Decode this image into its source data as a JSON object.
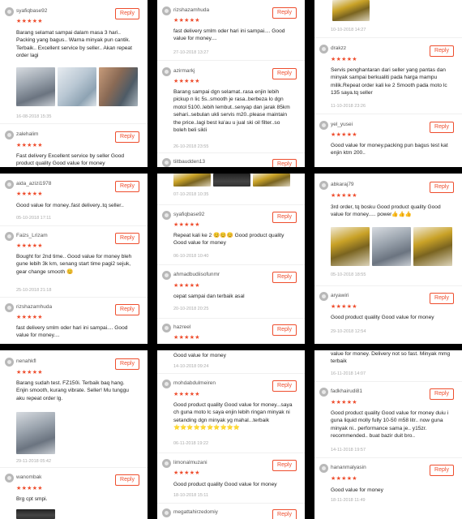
{
  "reply_label": "Reply",
  "stars": "★★★★★",
  "accent_color": "#ee4d2d",
  "tiles": [
    {
      "reviews": [
        {
          "user": "syafiqbase92",
          "text": "Barang selamat sampai dalam masa 3 hari.. Packing yang bagus.. Warna minyak pun cantik. Terbaik.. Excellent service by seller.. Akan repeat order lagi",
          "time": "16-08-2018 15:35"
        },
        {
          "user": "zalehalim",
          "text": "Fast delivery Excellent service by seller Good product quality Good value for money",
          "time": ""
        }
      ]
    },
    {
      "reviews": [
        {
          "user": "rizshazamhuda",
          "text": "fast delivery smlm oder hari ini sampai.... Good value for money....",
          "time": "27-10-2018 13:27"
        },
        {
          "user": "azirmarkj",
          "text": "Barang sampai dgn selamat..rasa enjin lebih pickup n lic 5s..smooth je rasa..berbeza lo dgn motol 5100..lebih lembut..senyap dan jarak 85km sehari..sebulan ukli servis m20..please maintain the price..lagi best ka'au u jual ski oil filter..so boleh beli sikli",
          "time": "26-10-2018 23:55"
        },
        {
          "user": "tiitbaudden13",
          "text": "",
          "time": ""
        }
      ]
    },
    {
      "reviews": [
        {
          "user": "",
          "text": "",
          "time": "10-10-2018 14:27"
        },
        {
          "user": "drakzz",
          "text": "Servis penghantaran dari seller yang pantas dan minyak sampai berkualiti pada harga mampu milik.Repeat order kali ke 2 Smooth pada moto lc 135 saya.tq seller",
          "time": "11-10-2018 23:26"
        },
        {
          "user": "yel_yusei",
          "text": "Good value for money.packing pun bagus test kat enjin ktm 200..",
          "time": ""
        }
      ]
    },
    {
      "reviews": [
        {
          "user": "aida_azizi1978",
          "text": "Good value for money..fast delivery..tq seller..",
          "time": "05-10-2018 17:11"
        },
        {
          "user": "Faizs_Lrizam",
          "text": "Bought for 2nd time.. Good value for money bleh gune lebih 3k km, senang start time pagi2 sejuk, gear change smooth 😊",
          "time": "25-10-2018 21:18"
        },
        {
          "user": "rizshazamhuda",
          "text": "fast delivery smlm oder hari ini sampai.... Good value for money....",
          "time": ""
        }
      ]
    },
    {
      "reviews": [
        {
          "user": "",
          "text": "",
          "time": "07-10-2018 10:35"
        },
        {
          "user": "syafiqbase92",
          "text": "Repeat kali ke 2 😊😊😊 Good product quality Good value for money",
          "time": "06-10-2018 10:40"
        },
        {
          "user": "ahmadbudiisofunmr",
          "text": "cepat sampai dan terbaik asal",
          "time": "20-10-2018 20:25"
        },
        {
          "user": "hazreel",
          "text": "",
          "time": ""
        }
      ]
    },
    {
      "reviews": [
        {
          "user": "abkaraj79",
          "text": "3rd order, tq bosku Good product quality Good value for money..... power👍👍👍",
          "time": "05-10-2018 18:55"
        },
        {
          "user": "aryawiri",
          "text": "Good product quality Good value for money",
          "time": "29-10-2018 12:54"
        }
      ]
    },
    {
      "reviews": [
        {
          "user": "nenahkfl",
          "text": "Barang sudah test. FZ150i. Terbaik baq hang. Enjin smooth, kurang vibrate. Seller! Mu tunggu aku repeat order lg.",
          "time": "29-11-2018 05:42"
        },
        {
          "user": "wanombak",
          "text": "Brg cpt smpi.",
          "time": ""
        }
      ]
    },
    {
      "reviews": [
        {
          "user": "",
          "text": "Good value for money",
          "time": "14-10-2018 09:24"
        },
        {
          "user": "mohdabdulmeiren",
          "text": "Good product quality Good value for money...saya ch guna moto lc saya enjin lebih ringan minyak ni setanding dgn minyak yg mahal...terbaik ⭐⭐⭐⭐⭐⭐⭐⭐⭐⭐",
          "time": "06-11-2018 19:22"
        },
        {
          "user": "limonalmuzani",
          "text": "Good product quality Good value for money",
          "time": "18-10-2018 15:11"
        },
        {
          "user": "megattahirzedomiy",
          "text": "",
          "time": ""
        }
      ]
    },
    {
      "reviews": [
        {
          "user": "",
          "text": "value for money. Delivery not so fast. Minyak mmg terbaik",
          "time": "16-11-2018 14:07"
        },
        {
          "user": "fadkhairudi81",
          "text": "Good product quality Good value for money duiu i guna liquid molly fully 10-50 m58 litr.. now guna minyak ni.. performance sama je.. y15zr. recommended.. buat bazir duit bro..",
          "time": "14-11-2018 19:57"
        },
        {
          "user": "hananmalyasin",
          "text": "Good value for money",
          "time": "18-11-2018 11:49"
        }
      ]
    }
  ]
}
